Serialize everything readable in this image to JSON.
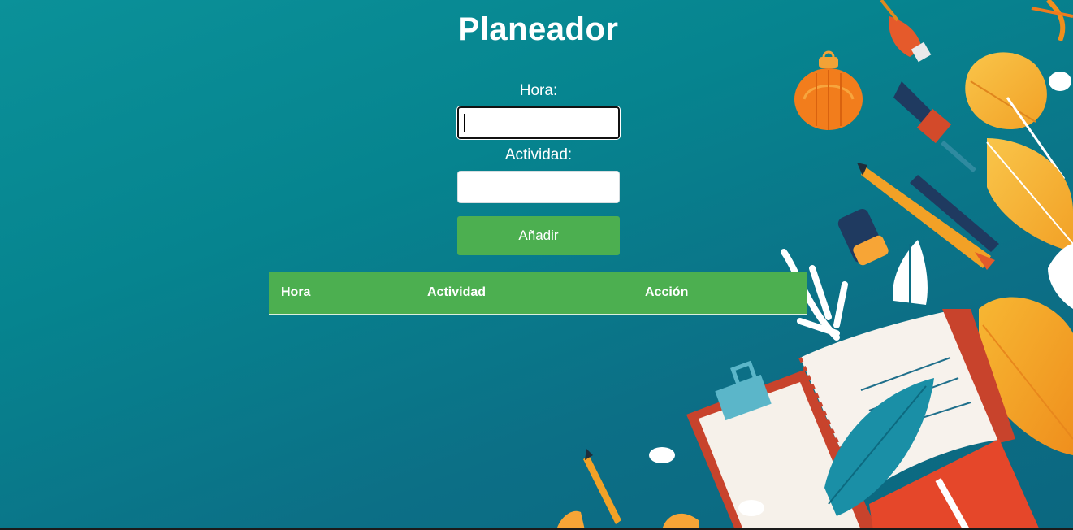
{
  "header": {
    "title": "Planeador"
  },
  "form": {
    "hora_label": "Hora:",
    "hora_value": "",
    "actividad_label": "Actividad:",
    "actividad_value": "",
    "add_button_label": "Añadir"
  },
  "table": {
    "columns": [
      "Hora",
      "Actividad",
      "Acción"
    ],
    "rows": []
  },
  "colors": {
    "background": "#0b8791",
    "accent_green": "#4caf50",
    "text": "#ffffff"
  },
  "decoration": {
    "theme": "stationery-and-autumn-leaves-illustration",
    "icons": [
      "leaf-icon",
      "pencil-icon",
      "notebook-icon",
      "lantern-icon",
      "brush-icon",
      "eraser-icon"
    ]
  }
}
